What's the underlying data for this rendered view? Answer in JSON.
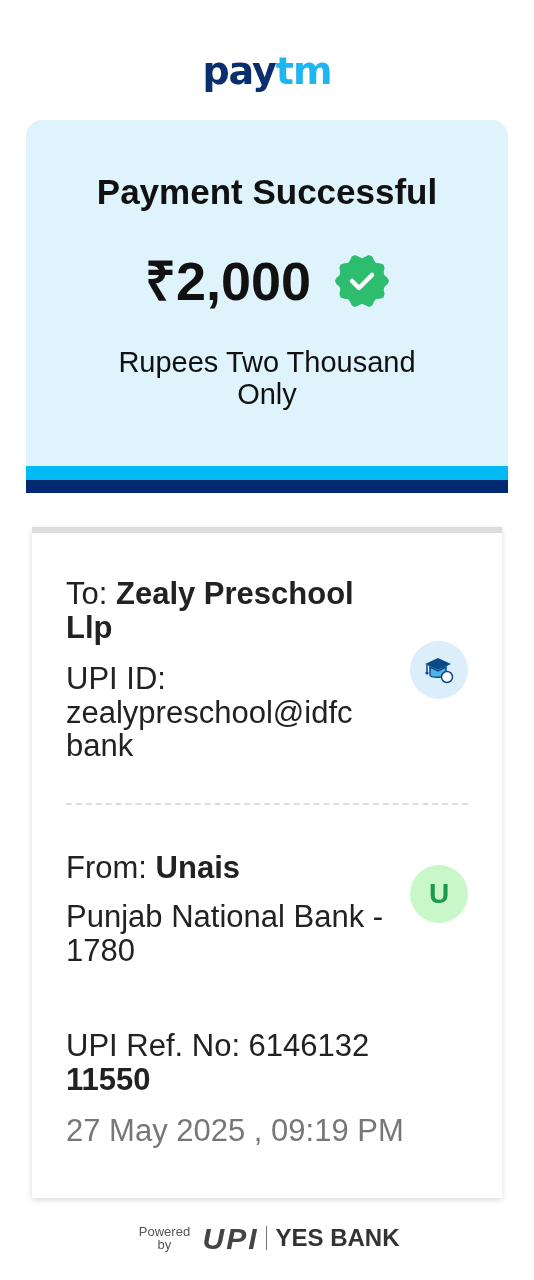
{
  "logo": {
    "first": "pay",
    "second": "tm"
  },
  "summary": {
    "title": "Payment Successful",
    "amount": "₹2,000",
    "kind": "success",
    "amount_words": "Rupees Two Thousand Only"
  },
  "receipt": {
    "to": {
      "label": "To:",
      "name": "Zealy Preschool Llp",
      "upi_label": "UPI ID:",
      "upi_id": "zealypreschool@idfc bank",
      "kind": "icon"
    },
    "from": {
      "label": "From:",
      "name": "Unais",
      "bank": "Punjab National Bank - 1780",
      "kind": "letter",
      "avatar_letter": "U"
    },
    "reference": {
      "label": "UPI Ref. No: 6146132",
      "number": "11550"
    },
    "datetime": "27 May 2025 , 09:19 PM"
  },
  "footer": {
    "powered": "Powered by",
    "upi": "UPI",
    "bank": "YES BANK"
  }
}
